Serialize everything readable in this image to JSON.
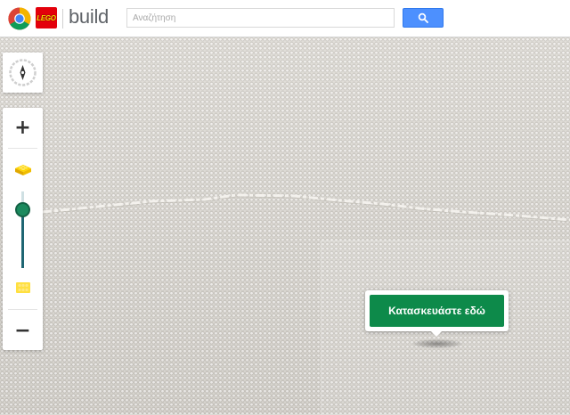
{
  "header": {
    "lego_logo_text": "LEGO",
    "brand_word": "build",
    "search": {
      "placeholder": "Αναζήτηση",
      "value": ""
    },
    "search_button_icon": "search-icon"
  },
  "map": {
    "compass_icon": "compass-icon",
    "zoom_in_label": "+",
    "zoom_out_label": "−",
    "single_brick_icon": "lego-brick-icon",
    "brick_plate_icon": "lego-plate-icon",
    "zoom_level": 0.75
  },
  "callout": {
    "build_here_label": "Κατασκευάστε εδώ"
  },
  "colors": {
    "accent_blue": "#4d90fe",
    "build_green": "#0d8a4a",
    "slider_teal": "#1e6673",
    "lego_red": "#e3000b",
    "lego_yellow": "#ffd500"
  }
}
